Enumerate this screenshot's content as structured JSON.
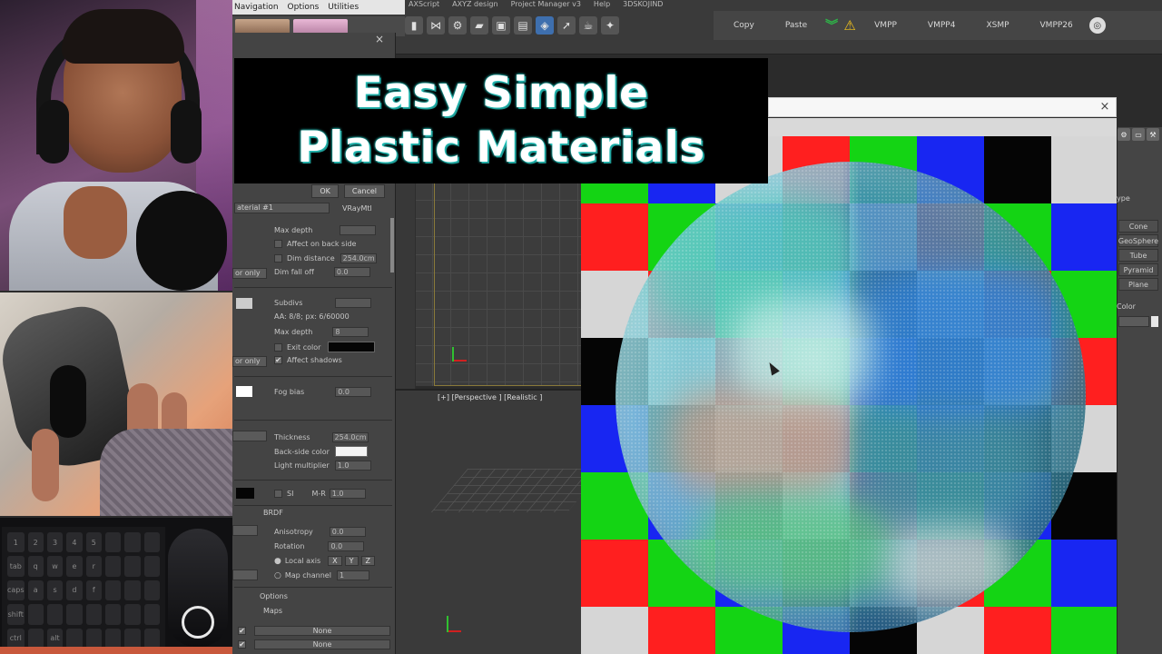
{
  "title_overlay": {
    "line1": "Easy Simple",
    "line2": "Plastic Materials"
  },
  "webcam": {
    "keyboard_keys": [
      "1",
      "2",
      "3",
      "4",
      "5",
      "",
      "",
      "",
      "tab",
      "q",
      "w",
      "e",
      "r",
      "",
      "",
      "",
      "caps",
      "a",
      "s",
      "d",
      "f",
      "",
      "",
      "",
      "shift",
      "",
      "",
      "",
      "",
      "",
      "",
      "",
      "ctrl",
      "",
      "alt",
      "",
      "",
      "",
      "",
      ""
    ]
  },
  "mini_menu": {
    "items": [
      "Navigation",
      "Options",
      "Utilities"
    ]
  },
  "top_menu": {
    "items": [
      "AXScript",
      "AXYZ design",
      "Project Manager v3",
      "Help",
      "3DSKOJIND"
    ]
  },
  "toolbar_icons": [
    "script-icon",
    "merge-icon",
    "design-icon",
    "folder-icon",
    "image-icon",
    "display-icon",
    "cube-icon",
    "arrow-icon",
    "kettle-icon",
    "wand-icon"
  ],
  "script_bar": {
    "copy_label": "Copy",
    "paste_label": "Paste",
    "buttons": [
      "VMPP",
      "VMPP4",
      "XSMP",
      "VMPP26"
    ]
  },
  "material_editor": {
    "ok_label": "OK",
    "cancel_label": "Cancel",
    "material_name": "aterial #1",
    "material_type": "VRayMtl",
    "reflection": {
      "max_depth_label": "Max depth",
      "affect_back_label": "Affect on back side",
      "dim_distance_label": "Dim distance",
      "dim_distance_value": "254.0cm",
      "dim_falloff_label": "Dim fall off",
      "dim_falloff_value": "0.0",
      "mode_dropdown": "or only"
    },
    "refraction": {
      "subdivs_label": "Subdivs",
      "aa_label": "AA: 8/8; px: 6/60000",
      "max_depth_label": "Max depth",
      "max_depth_value": "8",
      "exit_color_label": "Exit color",
      "affect_shadows_label": "Affect shadows",
      "mode_dropdown": "or only"
    },
    "fog": {
      "fog_bias_label": "Fog bias",
      "fog_bias_value": "0.0"
    },
    "translucency": {
      "thickness_label": "Thickness",
      "thickness_value": "254.0cm",
      "backside_label": "Back-side color",
      "light_mult_label": "Light multiplier",
      "light_mult_value": "1.0"
    },
    "si_row": {
      "si_label": "SI",
      "mr_label": "M-R",
      "mr_value": "1.0"
    },
    "brdf": {
      "header": "BRDF",
      "anisotropy_label": "Anisotropy",
      "anisotropy_value": "0.0",
      "rotation_label": "Rotation",
      "rotation_value": "0.0",
      "local_axis_label": "Local axis",
      "axes": [
        "X",
        "Y",
        "Z"
      ],
      "map_channel_label": "Map channel",
      "map_channel_value": "1"
    },
    "options_label": "Options",
    "maps_label": "Maps",
    "map_slots": [
      "None",
      "None"
    ]
  },
  "viewport": {
    "perspective_label": "[+] [Perspective ] [Realistic ]"
  },
  "render_window": {
    "checker_colors": {
      "red": "#ff1f1f",
      "green": "#14d414",
      "blue": "#1826f2",
      "black": "#050505",
      "grey": "#d6d6d6"
    },
    "checker_rows": [
      [
        "green",
        "blue",
        "grey",
        "red",
        "green",
        "blue",
        "black",
        "grey",
        "grey"
      ],
      [
        "red",
        "green",
        "blue",
        "black",
        "grey",
        "red",
        "green",
        "blue",
        "black"
      ],
      [
        "grey",
        "red",
        "green",
        "blue",
        "black",
        "grey",
        "red",
        "green",
        "blue"
      ],
      [
        "black",
        "grey",
        "red",
        "green",
        "blue",
        "black",
        "grey",
        "red",
        "green"
      ],
      [
        "blue",
        "black",
        "grey",
        "red",
        "green",
        "blue",
        "black",
        "grey",
        "red"
      ],
      [
        "green",
        "blue",
        "black",
        "grey",
        "red",
        "green",
        "blue",
        "black",
        "grey"
      ],
      [
        "red",
        "green",
        "blue",
        "black",
        "grey",
        "red",
        "green",
        "blue",
        "black"
      ],
      [
        "grey",
        "red",
        "green",
        "blue",
        "black",
        "grey",
        "red",
        "green",
        "blue"
      ]
    ],
    "close_glyph": "×"
  },
  "command_panel": {
    "section_label": "ype",
    "objects": [
      "Cone",
      "GeoSphere",
      "Tube",
      "Pyramid",
      "Plane"
    ],
    "color_label": "Color"
  }
}
